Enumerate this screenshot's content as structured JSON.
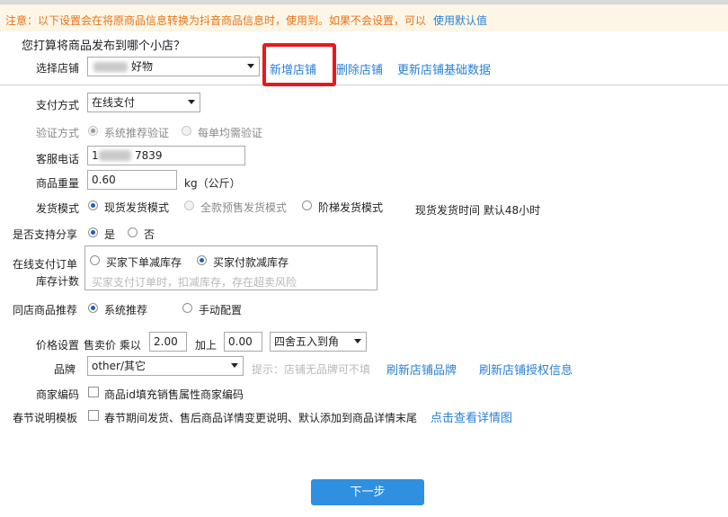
{
  "notice": {
    "text": "注意：以下设置会在将原商品信息转换为抖音商品信息时，使用到。如果不会设置，可以",
    "default_link": "使用默认值"
  },
  "store": {
    "question": "您打算将商品发布到哪个小店？",
    "label": "选择店铺",
    "selected": "好物",
    "add_link": "新增店铺",
    "delete_link": "删除店铺",
    "refresh_link": "更新店铺基础数据"
  },
  "payment": {
    "label": "支付方式",
    "value": "在线支付"
  },
  "verify": {
    "label": "验证方式",
    "options": [
      "系统推荐验证",
      "每单均需验证"
    ]
  },
  "phone": {
    "label": "客服电话",
    "prefix": "1",
    "suffix": "7839"
  },
  "weight": {
    "label": "商品重量",
    "value": "0.60",
    "unit": "kg（公斤）"
  },
  "shipping": {
    "label": "发货模式",
    "options": [
      "现货发货模式",
      "全款预售发货模式",
      "阶梯发货模式"
    ],
    "time_label": "现货发货时间 默认48小时"
  },
  "share": {
    "label": "是否支持分享",
    "options": [
      "是",
      "否"
    ]
  },
  "stock": {
    "label_line1": "在线支付订单",
    "label_line2": "库存计数",
    "options": [
      "买家下单减库存",
      "买家付款减库存"
    ],
    "hint": "买家支付订单时，扣减库存，存在超卖风险"
  },
  "recommend": {
    "label": "同店商品推荐",
    "options": [
      "系统推荐",
      "手动配置"
    ]
  },
  "price": {
    "label": "价格设置",
    "sell_label": "售卖价 乘以",
    "multiplier": "2.00",
    "add_label": "加上",
    "addend": "0.00",
    "rounding": "四舍五入到角"
  },
  "brand": {
    "label": "品牌",
    "value": "other/其它",
    "hint": "提示：店铺无品牌可不填",
    "refresh_brand": "刷新店铺品牌",
    "refresh_auth": "刷新店铺授权信息"
  },
  "merchant_code": {
    "label": "商家编码",
    "checkbox_label": "商品id填充销售属性商家编码"
  },
  "festival": {
    "label": "春节说明模板",
    "checkbox_label": "春节期间发货、售后商品详情变更说明、默认添加到商品详情末尾",
    "detail_link": "点击查看详情图"
  },
  "next_button": "下一步",
  "colors": {
    "accent": "#2a7fd4",
    "warning": "#e8731a",
    "highlight": "#e6191e",
    "button": "#2f8fe0"
  }
}
